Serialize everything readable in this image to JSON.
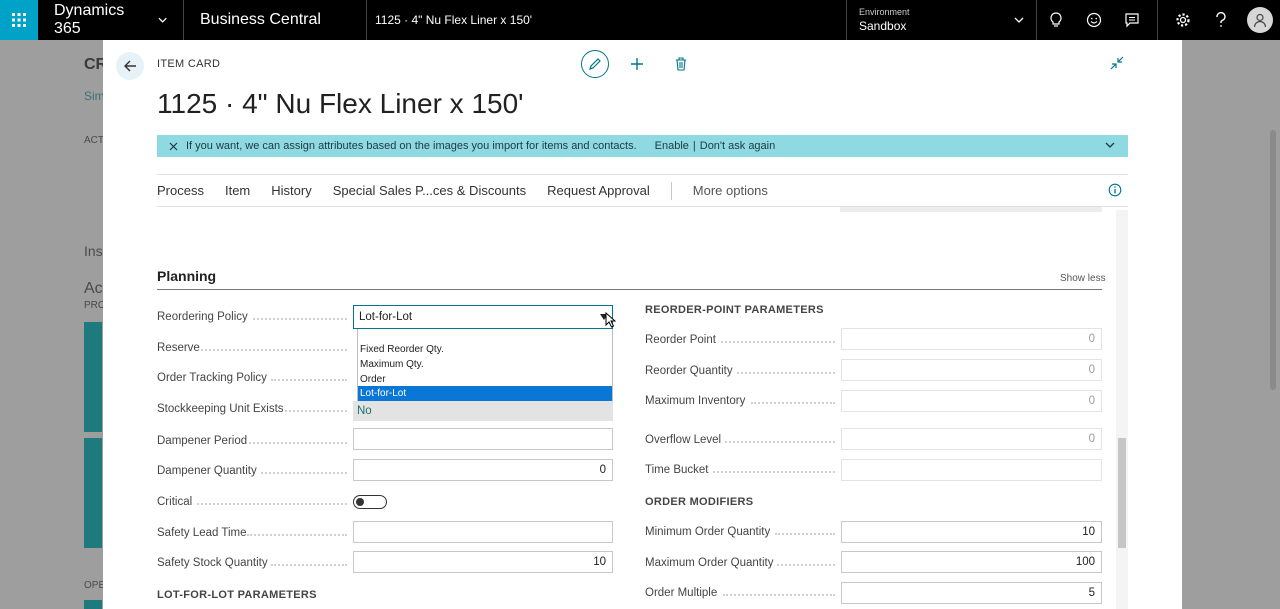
{
  "topbar": {
    "brand": "Dynamics 365",
    "app": "Business Central",
    "breadcrumb": "1125 · 4\" Nu Flex Liner x 150'",
    "env_label": "Environment",
    "env_value": "Sandbox"
  },
  "background": {
    "title_frag": "CR",
    "sub_frag": "Sim",
    "act_frag": "ACT",
    "ins_frag": "Ins",
    "acc_frag": "Ac",
    "pro_frag": "PRO",
    "ope_frag": "OPE"
  },
  "card": {
    "kind": "ITEM CARD",
    "title": "1125 · 4\" Nu Flex Liner x 150'"
  },
  "banner": {
    "message": "If you want, we can assign attributes based on the images you import for items and contacts.",
    "enable": "Enable",
    "pipe": "|",
    "dont_ask": "Don't ask again"
  },
  "actionbar": {
    "items": [
      "Process",
      "Item",
      "History",
      "Special Sales P...ces & Discounts",
      "Request Approval"
    ],
    "more": "More options"
  },
  "planning": {
    "title": "Planning",
    "show_less": "Show less",
    "left_fields": [
      {
        "label": "Reordering Policy",
        "value": "Lot-for-Lot"
      },
      {
        "label": "Reserve",
        "value": ""
      },
      {
        "label": "Order Tracking Policy",
        "value": ""
      },
      {
        "label": "Stockkeeping Unit Exists",
        "value": "No"
      },
      {
        "label": "Dampener Period",
        "value": ""
      },
      {
        "label": "Dampener Quantity",
        "value": "0"
      },
      {
        "label": "Critical",
        "value": ""
      },
      {
        "label": "Safety Lead Time",
        "value": ""
      },
      {
        "label": "Safety Stock Quantity",
        "value": "10"
      }
    ],
    "lot_heading": "LOT-FOR-LOT PARAMETERS",
    "dropdown_options": [
      "Fixed Reorder Qty.",
      "Maximum Qty.",
      "Order",
      "Lot-for-Lot"
    ],
    "reorder_heading": "REORDER-POINT PARAMETERS",
    "reorder_fields": [
      {
        "label": "Reorder Point",
        "value": "0"
      },
      {
        "label": "Reorder Quantity",
        "value": "0"
      },
      {
        "label": "Maximum Inventory",
        "value": "0"
      },
      {
        "label": "Overflow Level",
        "value": "0"
      },
      {
        "label": "Time Bucket",
        "value": ""
      }
    ],
    "modifiers_heading": "ORDER MODIFIERS",
    "modifier_fields": [
      {
        "label": "Minimum Order Quantity",
        "value": "10"
      },
      {
        "label": "Maximum Order Quantity",
        "value": "100"
      },
      {
        "label": "Order Multiple",
        "value": "5"
      }
    ]
  },
  "colors": {
    "accent": "#00a3c7",
    "banner": "#8fd9e3",
    "selected_option": "#0a77d6"
  }
}
